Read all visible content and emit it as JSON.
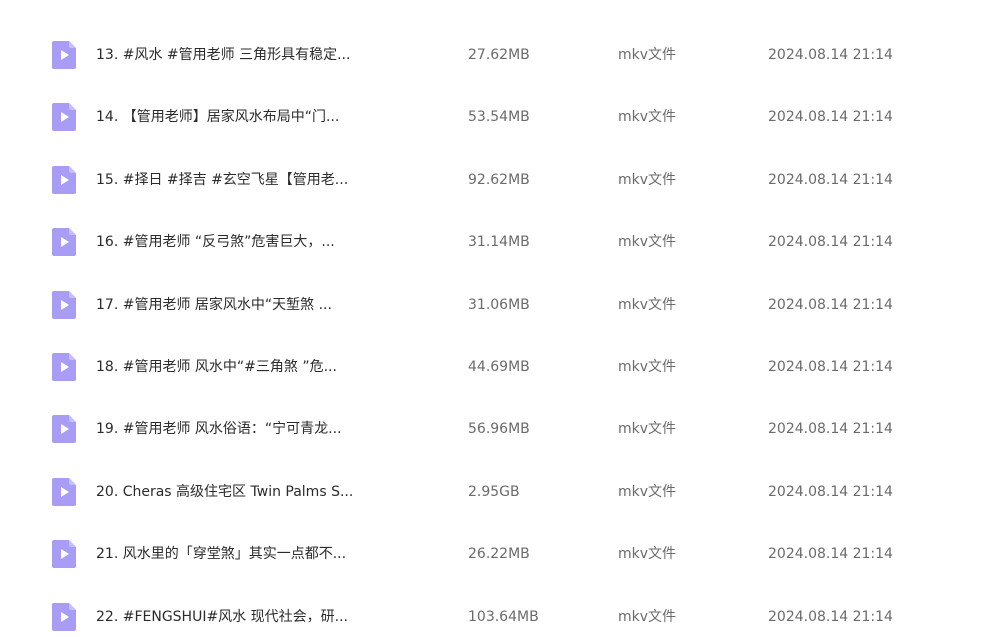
{
  "colors": {
    "icon_fill": "#a99cf5",
    "icon_fold": "#c7bff9",
    "name_text": "#2b2b2b",
    "meta_text": "#6b6b6b"
  },
  "files": [
    {
      "icon": "video-file-icon",
      "name": "13. #风水 #管用老师 三角形具有稳定...",
      "size": "27.62MB",
      "type": "mkv文件",
      "date": "2024.08.14 21:14"
    },
    {
      "icon": "video-file-icon",
      "name": "14. 【管用老师】居家风水布局中“门...",
      "size": "53.54MB",
      "type": "mkv文件",
      "date": "2024.08.14 21:14"
    },
    {
      "icon": "video-file-icon",
      "name": "15. #择日 #择吉 #玄空飞星【管用老...",
      "size": "92.62MB",
      "type": "mkv文件",
      "date": "2024.08.14 21:14"
    },
    {
      "icon": "video-file-icon",
      "name": "16. #管用老师 “反弓煞”危害巨大，...",
      "size": "31.14MB",
      "type": "mkv文件",
      "date": "2024.08.14 21:14"
    },
    {
      "icon": "video-file-icon",
      "name": "17. #管用老师 居家风水中“天堑煞 ...",
      "size": "31.06MB",
      "type": "mkv文件",
      "date": "2024.08.14 21:14"
    },
    {
      "icon": "video-file-icon",
      "name": "18. #管用老师 风水中“#三角煞 ”危...",
      "size": "44.69MB",
      "type": "mkv文件",
      "date": "2024.08.14 21:14"
    },
    {
      "icon": "video-file-icon",
      "name": "19. #管用老师 风水俗语：“宁可青龙...",
      "size": "56.96MB",
      "type": "mkv文件",
      "date": "2024.08.14 21:14"
    },
    {
      "icon": "video-file-icon",
      "name": "20. Cheras 高级住宅区 Twin Palms S...",
      "size": "2.95GB",
      "type": "mkv文件",
      "date": "2024.08.14 21:14"
    },
    {
      "icon": "video-file-icon",
      "name": "21. 风水里的「穿堂煞」其实一点都不...",
      "size": "26.22MB",
      "type": "mkv文件",
      "date": "2024.08.14 21:14"
    },
    {
      "icon": "video-file-icon",
      "name": "22. #FENGSHUI#风水 现代社会，研...",
      "size": "103.64MB",
      "type": "mkv文件",
      "date": "2024.08.14 21:14"
    }
  ]
}
